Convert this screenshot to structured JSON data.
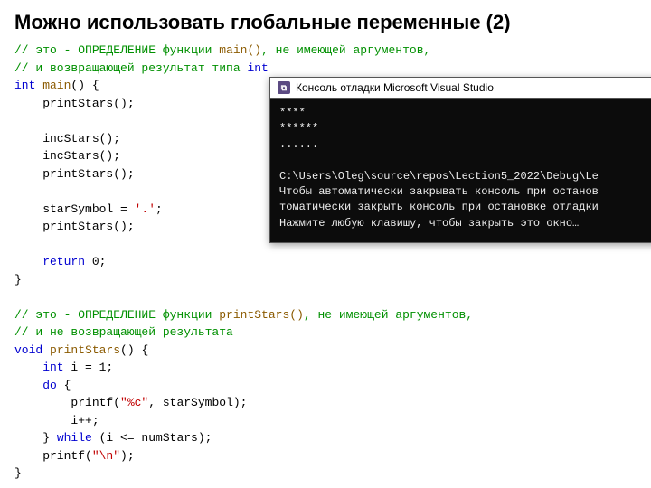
{
  "title": "Можно использовать  глобальные переменные (2)",
  "code": {
    "c1": "// это - ОПРЕДЕЛЕНИЕ функции ",
    "c1fn": "main()",
    "c1b": ", не имеющей аргументов,",
    "c2": "// и возвращающей результат типа ",
    "c2kw": "int",
    "l1_kw": "int",
    "l1_fn": " main",
    "l1_rest": "() {",
    "l2": "    printStars();",
    "l3": "    incStars();",
    "l4": "    incStars();",
    "l5": "    printStars();",
    "l6a": "    starSymbol = ",
    "l6s": "'.'",
    "l6b": ";",
    "l7": "    printStars();",
    "l8_kw": "    return",
    "l8_rest": " 0;",
    "l9": "}",
    "c3": "// это - ОПРЕДЕЛЕНИЕ функции ",
    "c3fn": "printStars()",
    "c3b": ", не имеющей аргументов,",
    "c4": "// и не возвращающей результата",
    "p1_kw": "void",
    "p1_fn": " printStars",
    "p1_rest": "() {",
    "p2_kw": "    int",
    "p2_rest": " i = 1;",
    "p3_kw": "    do",
    "p3_rest": " {",
    "p4a": "        printf(",
    "p4s": "\"%c\"",
    "p4b": ", starSymbol);",
    "p5": "        i++;",
    "p6a": "    } ",
    "p6_kw": "while",
    "p6b": " (i <= numStars);",
    "p7a": "    printf(",
    "p7s": "\"\\n\"",
    "p7b": ");",
    "p8": "}"
  },
  "console": {
    "title": "Консоль отладки Microsoft Visual Studio",
    "out1": "****",
    "out2": "******",
    "out3": "......",
    "blank": "",
    "path": "C:\\Users\\Oleg\\source\\repos\\Lection5_2022\\Debug\\Le",
    "msg1": "Чтобы автоматически закрывать консоль при останов",
    "msg2": "томатически закрыть консоль при остановке отладки",
    "msg3": "Нажмите любую клавишу, чтобы закрыть это окно…"
  }
}
